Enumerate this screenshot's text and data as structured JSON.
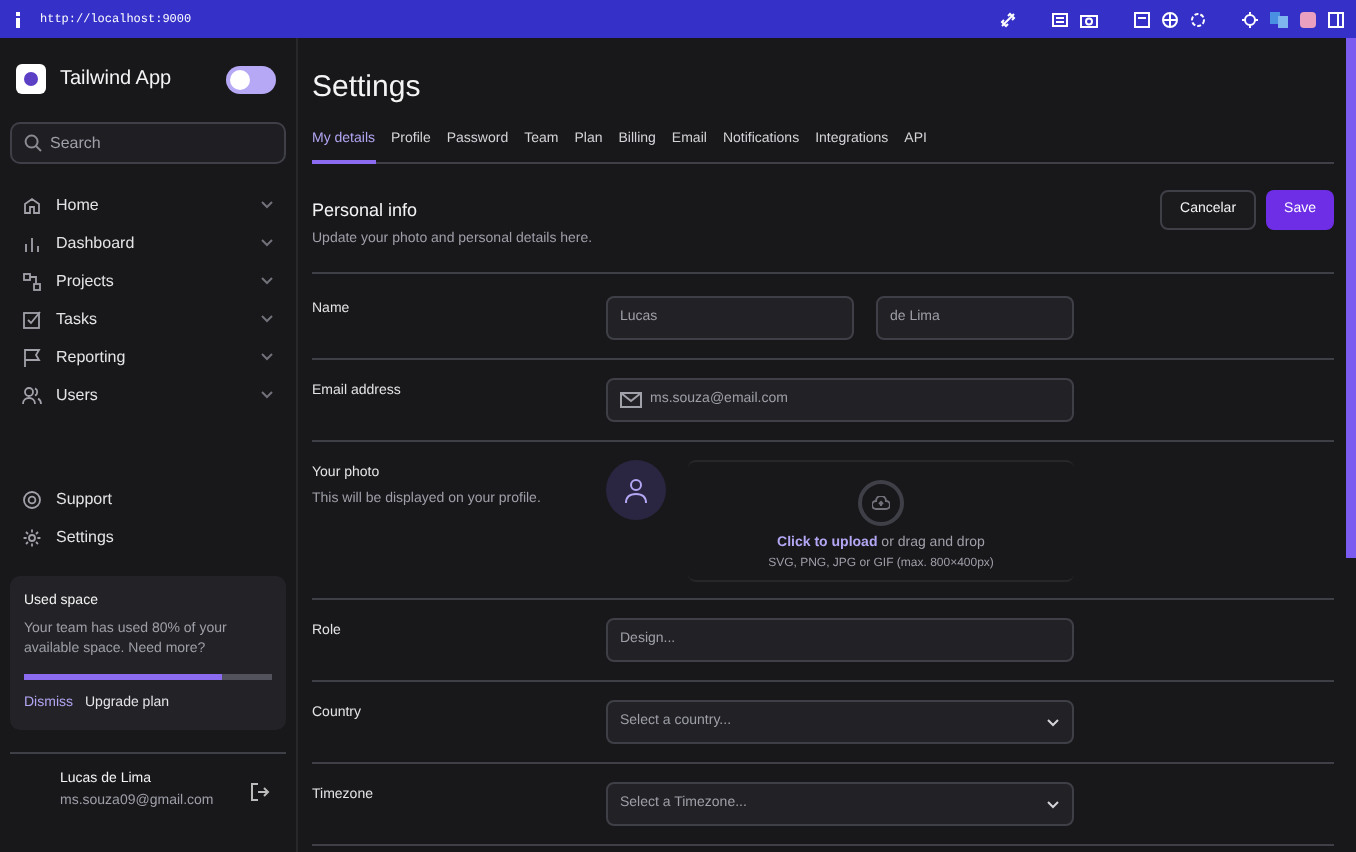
{
  "browser": {
    "url": "http://localhost:9000"
  },
  "sidebar": {
    "app_name": "Tailwind App",
    "theme_toggle": {
      "on": false
    },
    "search": {
      "placeholder": "Search"
    },
    "nav_items": [
      {
        "label": "Home"
      },
      {
        "label": "Dashboard"
      },
      {
        "label": "Projects"
      },
      {
        "label": "Tasks"
      },
      {
        "label": "Reporting"
      },
      {
        "label": "Users"
      }
    ],
    "footer_items": [
      {
        "label": "Support"
      },
      {
        "label": "Settings"
      }
    ],
    "usage_card": {
      "title": "Used space",
      "text": "Your team has used 80% of your available space. Need more?",
      "level": 0.8,
      "dismiss": "Dismiss",
      "upgrade": "Upgrade plan"
    },
    "user": {
      "name": "Lucas de Lima",
      "email": "ms.souza09@gmail.com"
    }
  },
  "main": {
    "title": "Settings",
    "tabs": [
      {
        "label": "My details",
        "selected": true
      },
      {
        "label": "Profile",
        "selected": false
      },
      {
        "label": "Password",
        "selected": false
      },
      {
        "label": "Team",
        "selected": false
      },
      {
        "label": "Plan",
        "selected": false
      },
      {
        "label": "Billing",
        "selected": false
      },
      {
        "label": "Email",
        "selected": false
      },
      {
        "label": "Notifications",
        "selected": false
      },
      {
        "label": "Integrations",
        "selected": false
      },
      {
        "label": "API",
        "selected": false
      }
    ],
    "section": {
      "title": "Personal info",
      "subtitle": "Update your photo and personal details here.",
      "cancel": "Cancelar",
      "save": "Save"
    },
    "rows": [
      {
        "kind": "name",
        "label": "Name",
        "first_placeholder": "Lucas",
        "last_placeholder": "de Lima"
      },
      {
        "kind": "email",
        "label": "Email address",
        "placeholder": "ms.souza@email.com"
      },
      {
        "kind": "photo",
        "label": "Your photo",
        "hint": "This will be displayed on your profile.",
        "upload_link": "Click to upload",
        "upload_text": "or drag and drop",
        "upload_formats": "SVG, PNG, JPG or GIF (max. 800×400px)"
      },
      {
        "kind": "text",
        "label": "Role",
        "placeholder": "Design..."
      },
      {
        "kind": "select",
        "label": "Country",
        "placeholder": "Select a country..."
      },
      {
        "kind": "select",
        "label": "Timezone",
        "placeholder": "Select a Timezone..."
      }
    ]
  }
}
